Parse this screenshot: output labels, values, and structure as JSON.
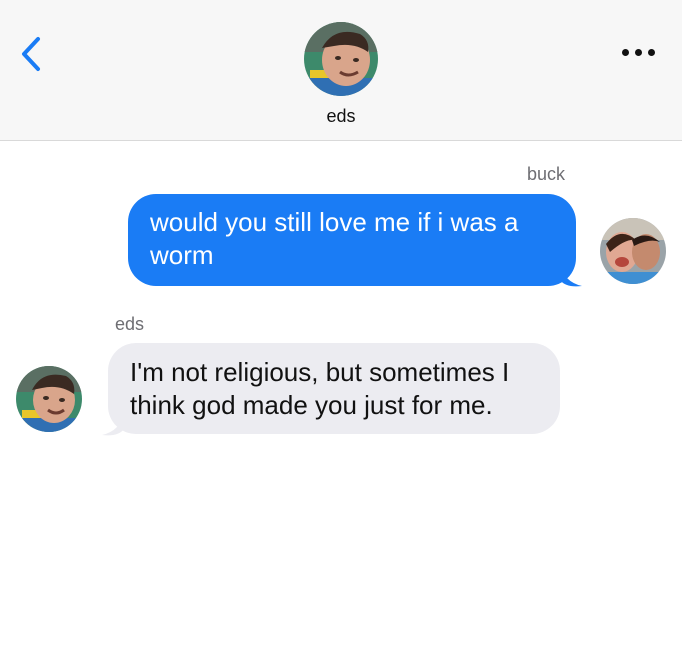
{
  "header": {
    "contact_name": "eds",
    "accent_color": "#1a7cf5",
    "back_icon": "chevron-left-icon",
    "more_icon": "ellipsis-icon"
  },
  "messages": [
    {
      "sender": "buck",
      "direction": "outgoing",
      "text": "would you still love me if i was a worm",
      "bubble_color": "#1a7cf5"
    },
    {
      "sender": "eds",
      "direction": "incoming",
      "text": "I'm not religious, but sometimes I think god made you just for me.",
      "bubble_color": "#ececf1"
    }
  ]
}
